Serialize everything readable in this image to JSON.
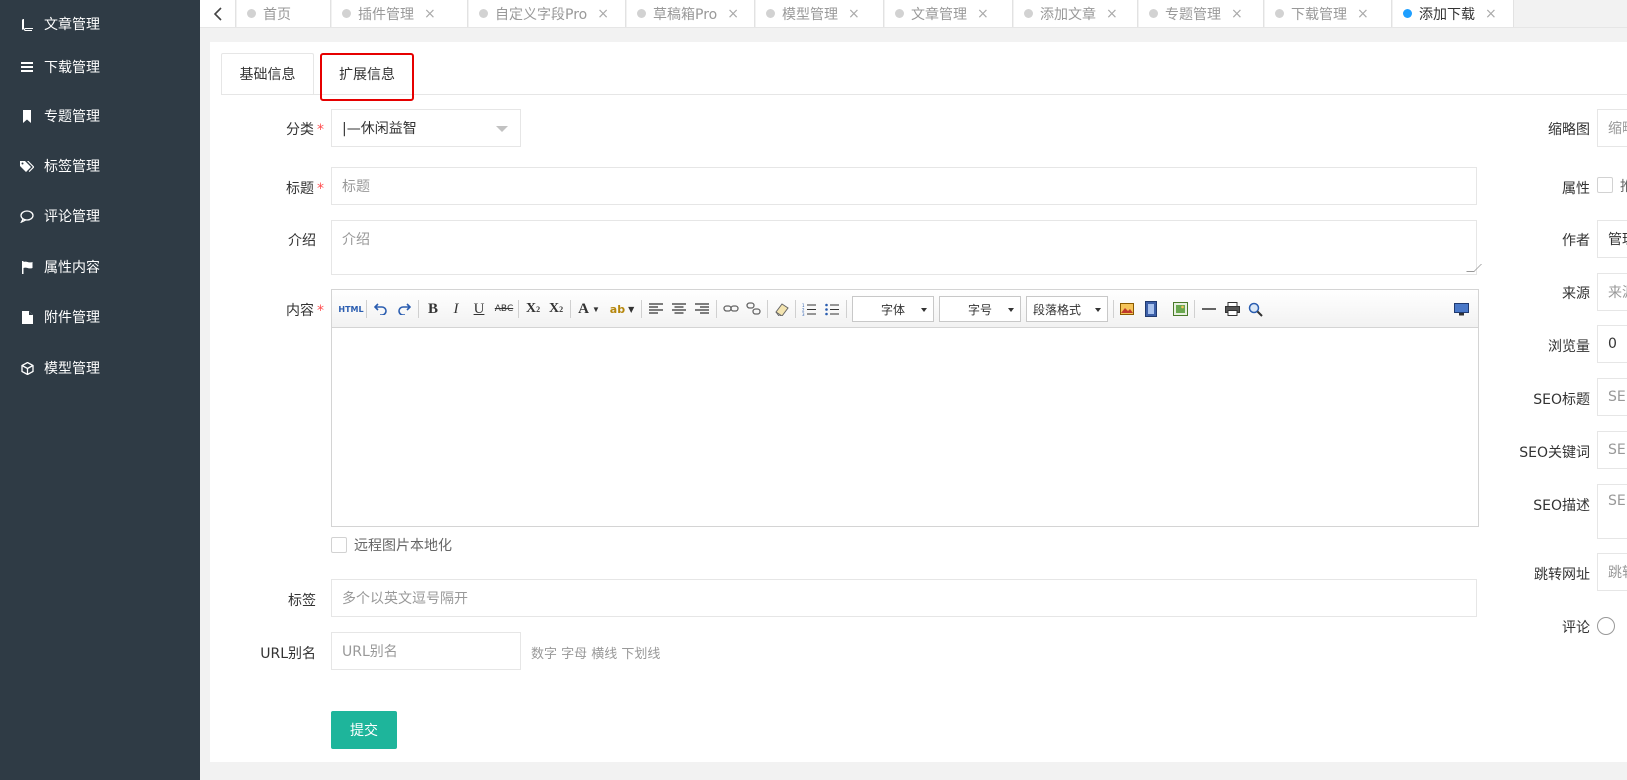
{
  "sidebar": {
    "items": [
      {
        "label": "文章管理",
        "icon": "book-icon"
      },
      {
        "label": "下载管理",
        "icon": "list-icon"
      },
      {
        "label": "专题管理",
        "icon": "bookmark-icon"
      },
      {
        "label": "标签管理",
        "icon": "tags-icon"
      },
      {
        "label": "评论管理",
        "icon": "comment-icon"
      },
      {
        "label": "属性内容",
        "icon": "flag-icon"
      },
      {
        "label": "附件管理",
        "icon": "file-icon"
      },
      {
        "label": "模型管理",
        "icon": "cube-icon"
      }
    ]
  },
  "tabs": {
    "back_icon": "chevron-left-icon",
    "items": [
      {
        "label": "首页"
      },
      {
        "label": "插件管理"
      },
      {
        "label": "自定义字段Pro"
      },
      {
        "label": "草稿箱Pro"
      },
      {
        "label": "模型管理"
      },
      {
        "label": "文章管理"
      },
      {
        "label": "添加文章"
      },
      {
        "label": "专题管理"
      },
      {
        "label": "下载管理"
      },
      {
        "label": "添加下载"
      }
    ],
    "close_glyph": "×",
    "active_color": "#1e9fff"
  },
  "subtabs": {
    "basic": "基础信息",
    "extended": "扩展信息"
  },
  "form": {
    "category": {
      "label": "分类",
      "value": "|—休闲益智"
    },
    "title": {
      "label": "标题",
      "placeholder": "标题"
    },
    "intro": {
      "label": "介绍",
      "placeholder": "介绍"
    },
    "content": {
      "label": "内容"
    },
    "required_mark": "*",
    "remote_image": {
      "label": "远程图片本地化"
    },
    "tags": {
      "label": "标签",
      "placeholder": "多个以英文逗号隔开"
    },
    "url_alias": {
      "label": "URL别名",
      "placeholder": "URL别名",
      "hint": "数字 字母 横线 下划线"
    },
    "submit_label": "提交",
    "submit_color": "#1eb59b"
  },
  "editor": {
    "html_label": "HTML",
    "font_label": "字体",
    "size_label": "字号",
    "paragraph_label": "段落格式"
  },
  "right_form": {
    "thumbnail": {
      "label": "缩略图",
      "placeholder": "缩略"
    },
    "attribute": {
      "label": "属性",
      "option": "推"
    },
    "author": {
      "label": "作者",
      "value": "管理"
    },
    "source": {
      "label": "来源",
      "placeholder": "来源"
    },
    "views": {
      "label": "浏览量",
      "value": "0"
    },
    "seo_title": {
      "label": "SEO标题",
      "placeholder": "SE"
    },
    "seo_keywords": {
      "label": "SEO关键词",
      "placeholder": "SE"
    },
    "seo_desc": {
      "label": "SEO描述",
      "placeholder": "SE"
    },
    "redirect": {
      "label": "跳转网址",
      "placeholder": "跳转"
    },
    "comment": {
      "label": "评论"
    }
  }
}
